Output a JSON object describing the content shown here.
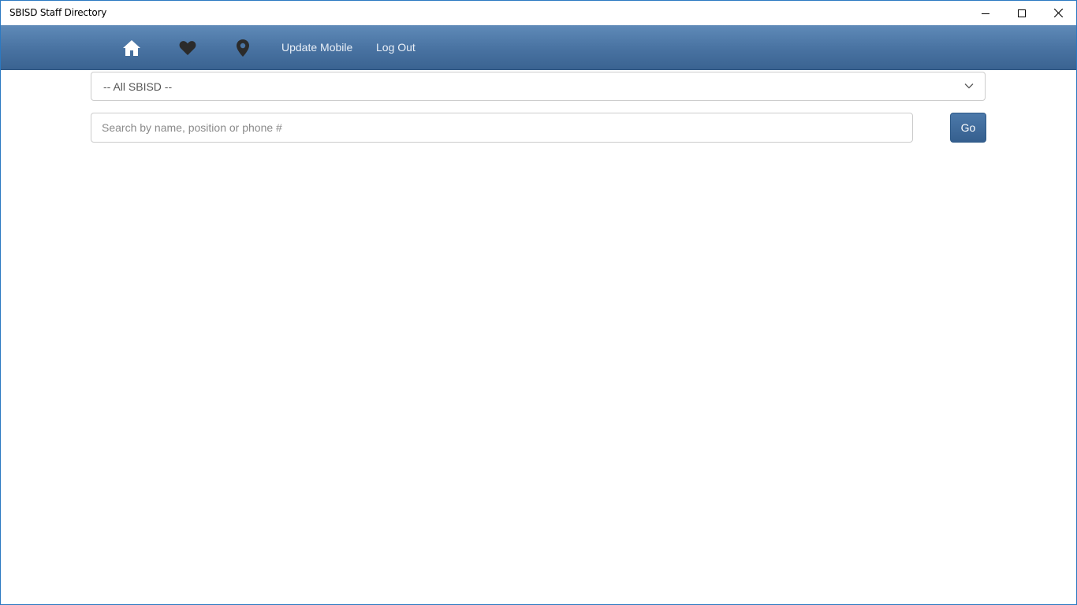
{
  "window": {
    "title": "SBISD Staff Directory",
    "controls": [
      "minimize",
      "maximize",
      "close"
    ]
  },
  "nav": {
    "icons": [
      "home-icon",
      "heart-icon",
      "map-pin-icon"
    ],
    "links": {
      "update_mobile": "Update Mobile",
      "log_out": "Log Out"
    }
  },
  "form": {
    "campus_select": {
      "selected": "-- All SBISD --"
    },
    "search": {
      "placeholder": "Search by name, position or phone #",
      "value": ""
    },
    "go_label": "Go"
  },
  "colors": {
    "navbar": "#4a74a3",
    "button": "#3f6a99",
    "window_border": "#2b79c2"
  }
}
